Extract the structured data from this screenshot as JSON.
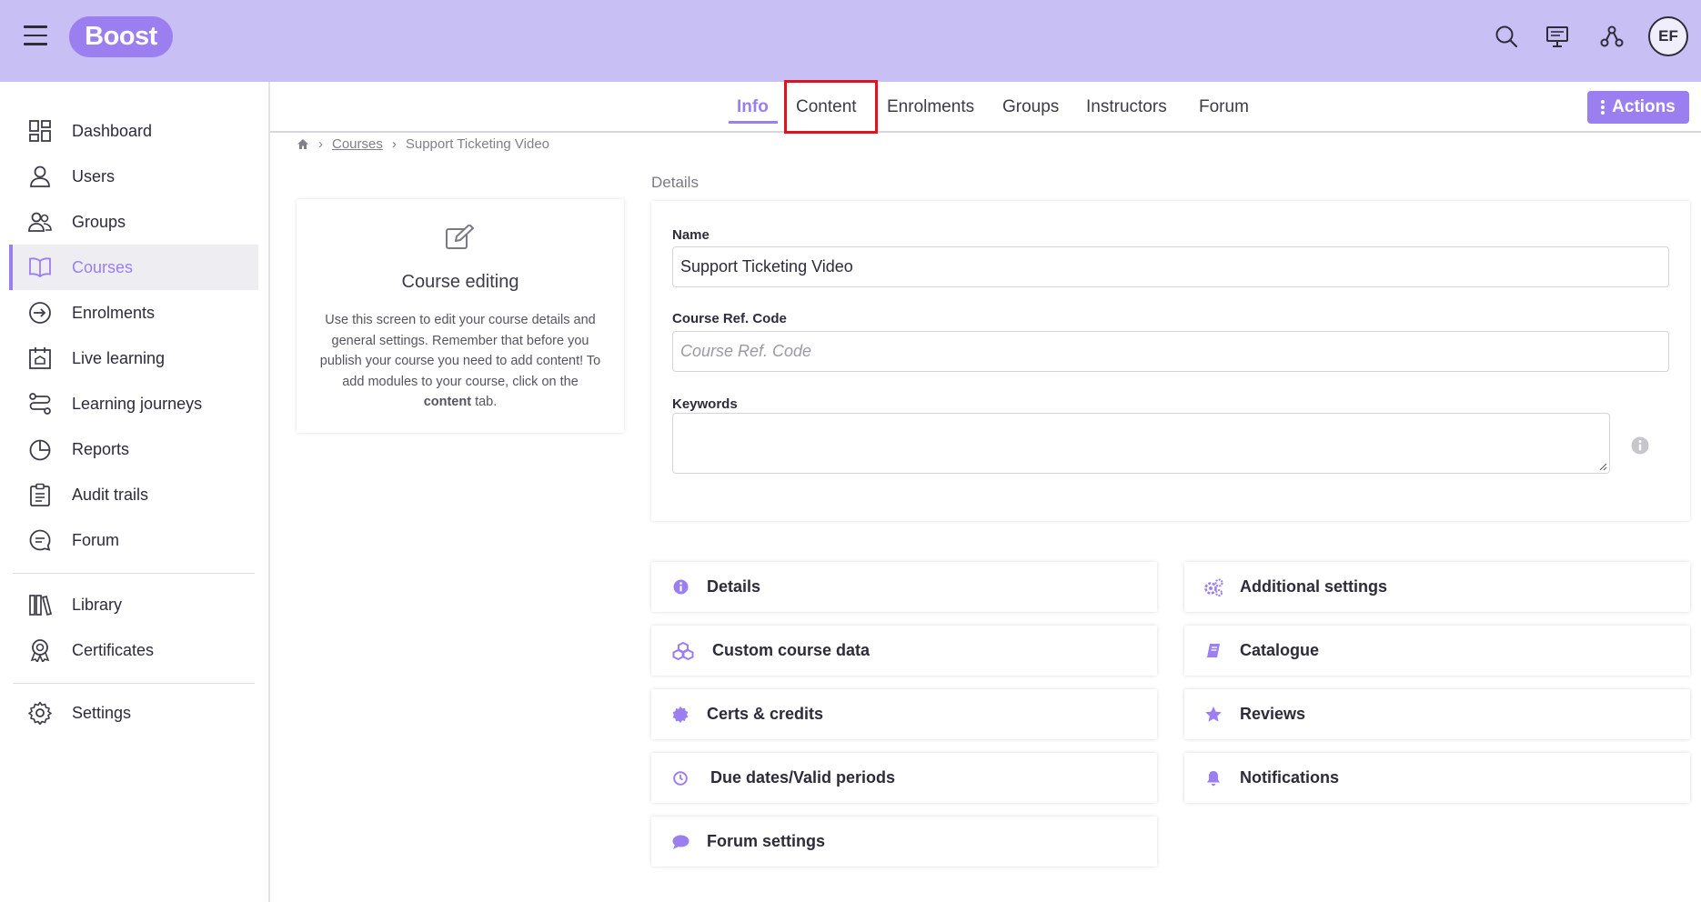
{
  "app": {
    "logo_text": "Boost"
  },
  "topbar": {
    "icons": [
      "search-icon",
      "presentation-icon",
      "network-icon"
    ],
    "avatar_initials": "EF"
  },
  "sidebar": {
    "items": [
      {
        "label": "Dashboard",
        "icon": "dashboard-icon"
      },
      {
        "label": "Users",
        "icon": "user-icon"
      },
      {
        "label": "Groups",
        "icon": "groups-icon"
      },
      {
        "label": "Courses",
        "icon": "book-open-icon",
        "active": true
      },
      {
        "label": "Enrolments",
        "icon": "enrol-icon"
      },
      {
        "label": "Live learning",
        "icon": "calendar-icon"
      },
      {
        "label": "Learning journeys",
        "icon": "journey-icon"
      },
      {
        "label": "Reports",
        "icon": "pie-chart-icon"
      },
      {
        "label": "Audit trails",
        "icon": "clipboard-icon"
      },
      {
        "label": "Forum",
        "icon": "chat-icon"
      },
      {
        "label": "Library",
        "icon": "library-icon"
      },
      {
        "label": "Certificates",
        "icon": "award-icon"
      },
      {
        "label": "Settings",
        "icon": "gear-icon"
      }
    ]
  },
  "tabs": [
    {
      "label": "Info",
      "active": true
    },
    {
      "label": "Content"
    },
    {
      "label": "Enrolments"
    },
    {
      "label": "Groups"
    },
    {
      "label": "Instructors"
    },
    {
      "label": "Forum"
    }
  ],
  "actions_label": "Actions",
  "breadcrumb": {
    "courses": "Courses",
    "current": "Support Ticketing Video"
  },
  "edit_card": {
    "title": "Course editing",
    "text_before": "Use this screen to edit your course details and general settings. Remember that before you publish your course you need to add content! To add modules to your course, click on the ",
    "text_bold": "content",
    "text_after": " tab."
  },
  "details": {
    "section_label": "Details",
    "name_label": "Name",
    "name_value": "Support Ticketing Video",
    "ref_label": "Course Ref. Code",
    "ref_placeholder": "Course Ref. Code",
    "keywords_label": "Keywords"
  },
  "sections": {
    "left": [
      {
        "label": "Details",
        "icon": "info-circle-icon"
      },
      {
        "label": "Custom course data",
        "icon": "cubes-icon"
      },
      {
        "label": "Certs & credits",
        "icon": "certificate-icon"
      },
      {
        "label": "Due dates/Valid periods",
        "icon": "clock-icon"
      },
      {
        "label": "Forum settings",
        "icon": "comment-icon"
      }
    ],
    "right": [
      {
        "label": "Additional settings",
        "icon": "cogs-icon"
      },
      {
        "label": "Catalogue",
        "icon": "book-icon"
      },
      {
        "label": "Reviews",
        "icon": "star-icon"
      },
      {
        "label": "Notifications",
        "icon": "bell-icon"
      }
    ]
  },
  "colors": {
    "accent": "#9b7ef0",
    "topbar": "#c8bff5",
    "highlight": "#e0141e"
  }
}
